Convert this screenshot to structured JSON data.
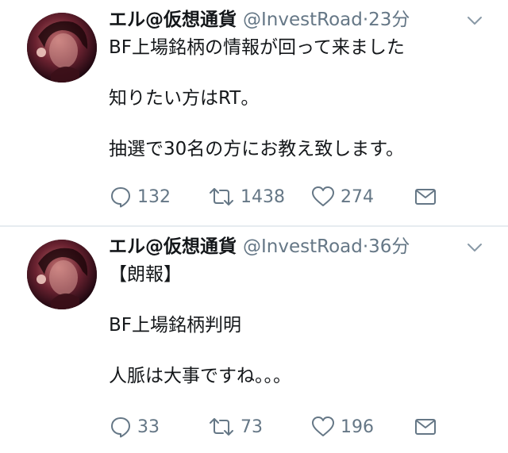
{
  "tweets": [
    {
      "display_name": "エル@仮想通貨",
      "handle": "@InvestRoad",
      "separator": "·",
      "time": "23分",
      "lines": [
        "BF上場銘柄の情報が回って来ました",
        "知りたい方はRT。",
        "抽選で30名の方にお教え致します。"
      ],
      "replies": "132",
      "retweets": "1438",
      "likes": "274"
    },
    {
      "display_name": "エル@仮想通貨",
      "handle": "@InvestRoad",
      "separator": "·",
      "time": "36分",
      "lines": [
        "【朗報】",
        "BF上場銘柄判明",
        "人脈は大事ですね。。。"
      ],
      "replies": "33",
      "retweets": "73",
      "likes": "196"
    }
  ],
  "icons": {
    "avatar": "dark-red-portrait-avatar",
    "menu": "chevron-down-icon",
    "reply": "reply-icon",
    "retweet": "retweet-icon",
    "like": "heart-icon",
    "dm": "envelope-icon"
  },
  "colors": {
    "text": "#14171a",
    "muted": "#657786",
    "divider": "#e6ecf0",
    "avatar_bg": "#2a0c14"
  }
}
